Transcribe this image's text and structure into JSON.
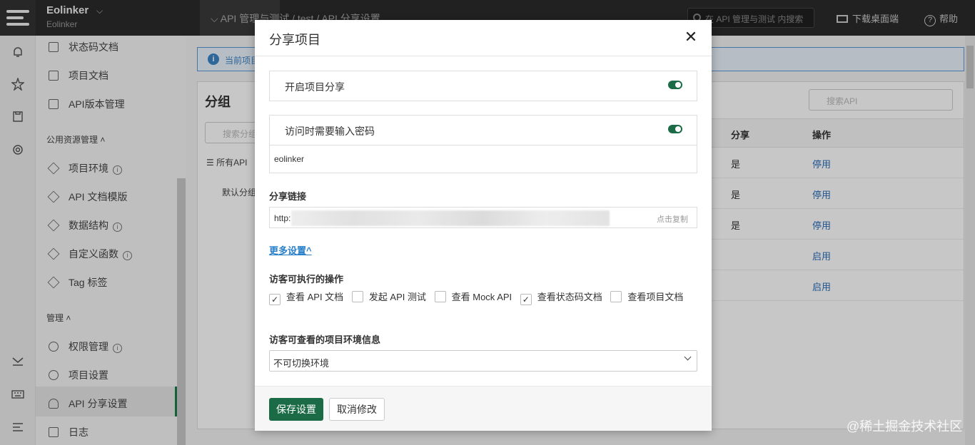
{
  "topbar": {
    "brand_name": "Eolinker",
    "brand_sub": "Eolinker",
    "breadcrumb": "API 管理与测试 / test / API 分享设置",
    "search_placeholder": "在 API 管理与测试 内搜索",
    "download_label": "下载桌面端",
    "help_label": "帮助"
  },
  "sidebar": {
    "items_top": [
      "状态码文档",
      "项目文档",
      "API版本管理"
    ],
    "group_public": "公用资源管理",
    "items_public": [
      "项目环境",
      "API 文档模版",
      "数据结构",
      "自定义函数",
      "Tag 标签"
    ],
    "group_manage": "管理",
    "items_manage": [
      "权限管理",
      "项目设置",
      "API 分享设置",
      "日志"
    ]
  },
  "main": {
    "notice": "当前项目",
    "panel_title": "分组",
    "group_search": "搜索分组",
    "all_api": "所有API",
    "default_group": "默认分组",
    "api_search": "搜索API",
    "col_share": "分享",
    "col_op": "操作",
    "rows": [
      {
        "share": "是",
        "op": "停用"
      },
      {
        "share": "是",
        "op": "停用"
      },
      {
        "share": "是",
        "op": "停用"
      },
      {
        "share": "",
        "op": "启用"
      },
      {
        "share": "",
        "op": "启用"
      }
    ]
  },
  "modal": {
    "title": "分享项目",
    "enable_share_label": "开启项目分享",
    "enable_share_on": true,
    "password_label": "访问时需要输入密码",
    "password_on": true,
    "password_value": "eolinker",
    "share_link_label": "分享链接",
    "share_link_prefix": "http:",
    "copy_label": "点击复制",
    "more_settings": "更多设置",
    "visitor_ops_label": "访客可执行的操作",
    "visitor_ops": [
      {
        "label": "查看 API 文档",
        "checked": true
      },
      {
        "label": "发起 API 测试",
        "checked": false
      },
      {
        "label": "查看 Mock API",
        "checked": false
      },
      {
        "label": "查看状态码文档",
        "checked": true
      },
      {
        "label": "查看项目文档",
        "checked": false
      }
    ],
    "env_label": "访客可查看的项目环境信息",
    "env_value": "不可切换环境",
    "save_button": "保存设置",
    "cancel_button": "取消修改"
  },
  "watermark": "@稀土掘金技术社区",
  "colors": {
    "primary": "#1b6b46",
    "link": "#2a7fc9",
    "topbar": "#2b2b2b"
  }
}
